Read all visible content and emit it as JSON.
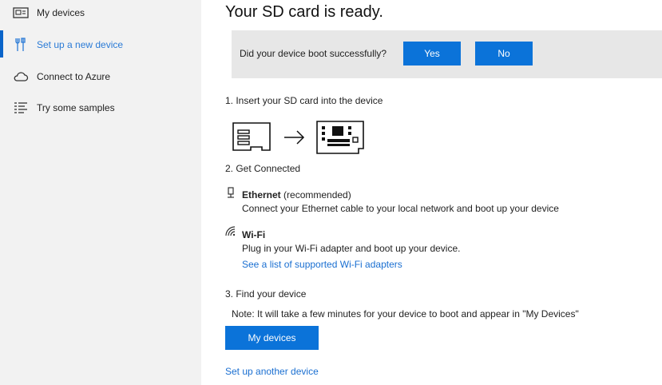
{
  "sidebar": {
    "items": [
      {
        "label": "My devices",
        "icon": "device-icon",
        "active": false
      },
      {
        "label": "Set up a new device",
        "icon": "tools-icon",
        "active": true
      },
      {
        "label": "Connect to Azure",
        "icon": "cloud-icon",
        "active": false
      },
      {
        "label": "Try some samples",
        "icon": "list-icon",
        "active": false
      }
    ]
  },
  "main": {
    "title": "Your SD card is ready.",
    "boot_question": "Did your device boot successfully?",
    "yes_label": "Yes",
    "no_label": "No",
    "step1": "1. Insert your SD card into the device",
    "step2": "2. Get Connected",
    "ethernet": {
      "title": "Ethernet",
      "suffix": " (recommended)",
      "desc": "Connect your Ethernet cable to your local network and boot up your device"
    },
    "wifi": {
      "title": "Wi-Fi",
      "desc": "Plug in your Wi-Fi adapter and boot up your device.",
      "link": "See a list of supported Wi-Fi adapters"
    },
    "step3": "3. Find your device",
    "note": "Note: It will take a few minutes for your device to boot and appear in \"My Devices\"",
    "my_devices_button": "My devices",
    "another_link": "Set up another device"
  },
  "colors": {
    "accent": "#0b73d9",
    "link": "#1a6fd1",
    "sidebar_bg": "#f2f2f2",
    "panel_bg": "#e7e7e7"
  }
}
